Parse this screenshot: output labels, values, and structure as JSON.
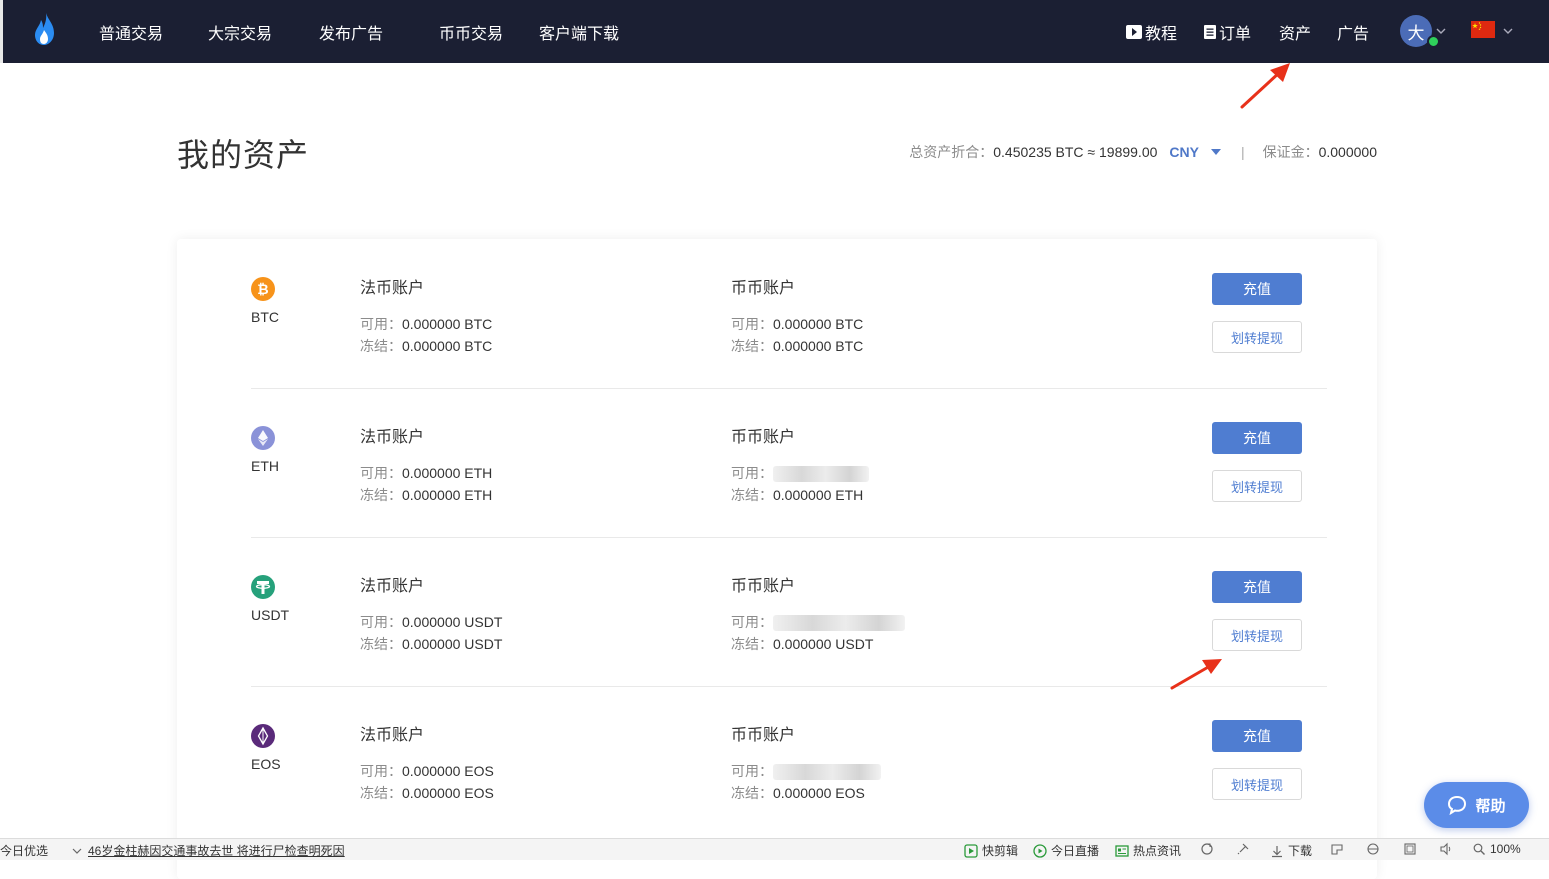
{
  "nav": {
    "items": [
      "普通交易",
      "大宗交易",
      "发布广告",
      "币币交易",
      "客户端下载"
    ],
    "tutorial": "教程",
    "orders": "订单",
    "assets": "资产",
    "ads": "广告",
    "avatar_char": "大"
  },
  "page": {
    "title": "我的资产",
    "summary_label": "总资产折合：",
    "summary_value": "0.450235 BTC ≈ 19899.00",
    "currency": "CNY",
    "separator": "|",
    "margin_label": "保证金：",
    "margin_value": "0.000000"
  },
  "labels": {
    "fiat_account": "法币账户",
    "coin_account": "币币账户",
    "available": "可用：",
    "frozen": "冻结：",
    "deposit": "充值",
    "transfer": "划转提现"
  },
  "assets": [
    {
      "coin": "BTC",
      "color": "#f7931a",
      "fiat_available": "0.000000 BTC",
      "fiat_frozen": "0.000000 BTC",
      "coin_available": "0.000000 BTC",
      "coin_frozen": "0.000000 BTC"
    },
    {
      "coin": "ETH",
      "color": "#8a92d8",
      "fiat_available": "0.000000 ETH",
      "fiat_frozen": "0.000000 ETH",
      "coin_available": "",
      "coin_frozen": "0.000000 ETH"
    },
    {
      "coin": "USDT",
      "color": "#26a17b",
      "fiat_available": "0.000000 USDT",
      "fiat_frozen": "0.000000 USDT",
      "coin_available": "",
      "coin_frozen": "0.000000 USDT"
    },
    {
      "coin": "EOS",
      "color": "#5a2a7a",
      "fiat_available": "0.000000 EOS",
      "fiat_frozen": "0.000000 EOS",
      "coin_available": "",
      "coin_frozen": "0.000000 EOS"
    }
  ],
  "help": {
    "label": "帮助"
  },
  "statusbar": {
    "left": "今日优选",
    "news": "46岁金柱赫因交通事故去世 将进行尸检查明死因",
    "quick_clip": "快剪辑",
    "live": "今日直播",
    "hot_news": "热点资讯",
    "download": "下载",
    "zoom": "100%"
  },
  "colors": {
    "navbar_bg": "#1b1f33",
    "primary": "#4f7dd1",
    "help_bg": "#5b8ce8",
    "arrow": "#e8311a"
  }
}
